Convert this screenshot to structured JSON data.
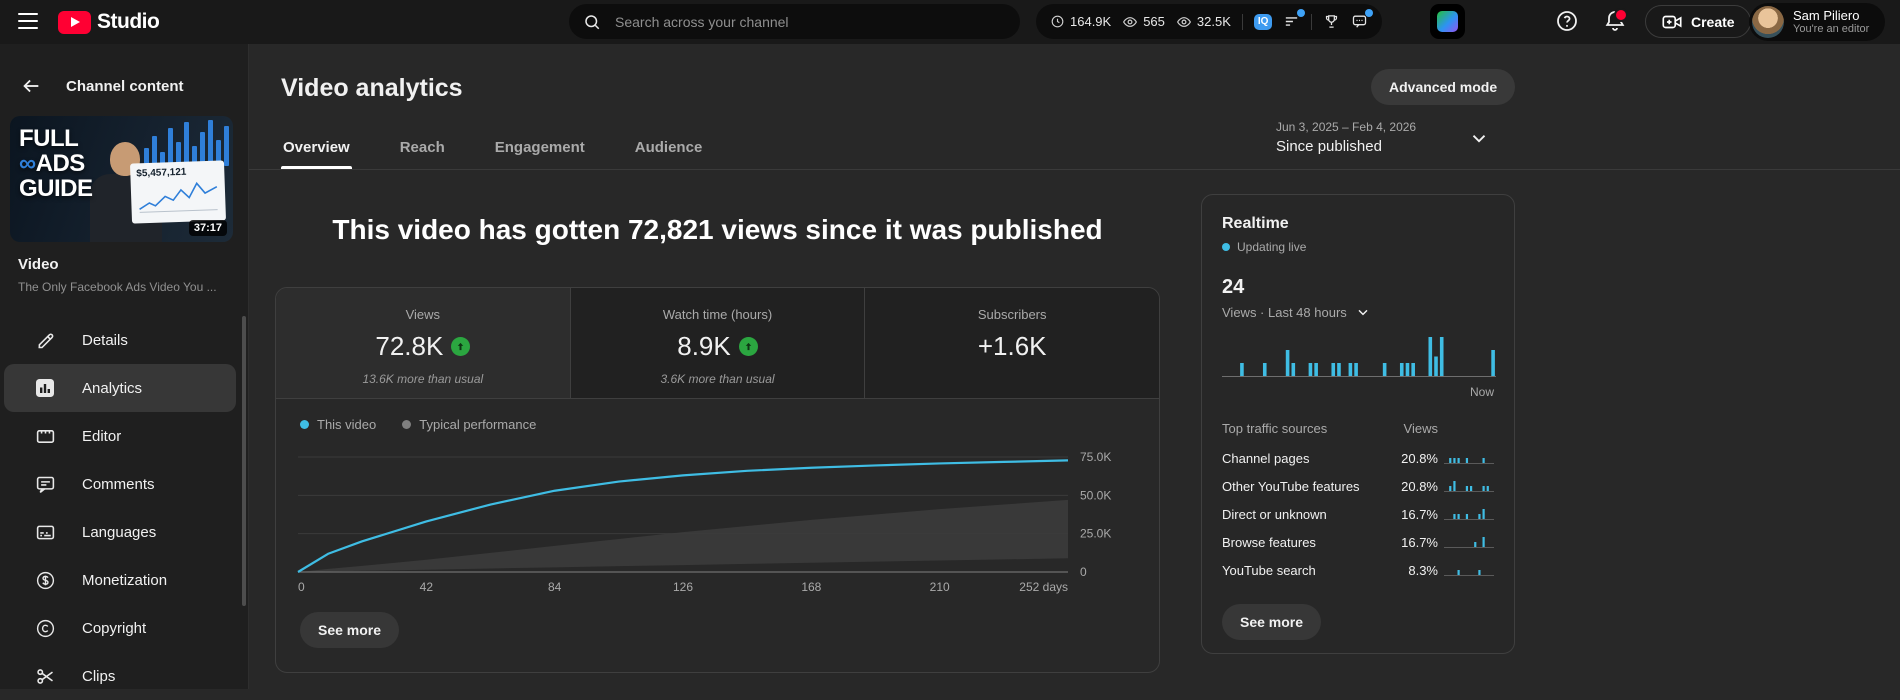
{
  "topbar": {
    "studio_label": "Studio",
    "search_placeholder": "Search across your channel",
    "stats": [
      {
        "icon": "clock",
        "value": "164.9K"
      },
      {
        "icon": "eye",
        "value": "565"
      },
      {
        "icon": "eye",
        "value": "32.5K"
      }
    ],
    "tools": [
      {
        "type": "divider"
      },
      {
        "type": "icon",
        "icon": "iq",
        "label": "IQ",
        "dot": false
      },
      {
        "type": "icon",
        "icon": "lines",
        "dot": true
      },
      {
        "type": "divider"
      },
      {
        "type": "icon",
        "icon": "trophy",
        "dot": false
      },
      {
        "type": "icon",
        "icon": "chat",
        "dot": true
      }
    ],
    "create_label": "Create",
    "user": {
      "name": "Sam Piliero",
      "role": "You're an editor"
    }
  },
  "sidebar": {
    "back_label": "Channel content",
    "thumbnail": {
      "line1": "FULL",
      "line2": "ADS",
      "line3": "GUIDE",
      "stat": "$5,457,121",
      "duration": "37:17"
    },
    "video_title": "Video",
    "video_subtitle": "The Only Facebook Ads Video You ...",
    "items": [
      {
        "label": "Details",
        "icon": "pencil",
        "active": false
      },
      {
        "label": "Analytics",
        "icon": "analytics",
        "active": true
      },
      {
        "label": "Editor",
        "icon": "editor",
        "active": false
      },
      {
        "label": "Comments",
        "icon": "comment",
        "active": false
      },
      {
        "label": "Languages",
        "icon": "subtitles",
        "active": false
      },
      {
        "label": "Monetization",
        "icon": "dollar",
        "active": false
      },
      {
        "label": "Copyright",
        "icon": "copyright",
        "active": false
      },
      {
        "label": "Clips",
        "icon": "scissors",
        "active": false
      }
    ]
  },
  "header": {
    "title": "Video analytics",
    "advanced_mode_label": "Advanced mode",
    "tabs": [
      "Overview",
      "Reach",
      "Engagement",
      "Audience"
    ],
    "active_tab": "Overview",
    "date_range": "Jun 3, 2025 – Feb 4, 2026",
    "date_mode": "Since published"
  },
  "main": {
    "headline": "This video has gotten 72,821 views since it was published",
    "metrics": [
      {
        "label": "Views",
        "value": "72.8K",
        "trend": "up",
        "note": "13.6K more than usual",
        "selected": true
      },
      {
        "label": "Watch time (hours)",
        "value": "8.9K",
        "trend": "up",
        "note": "3.6K more than usual",
        "selected": false
      },
      {
        "label": "Subscribers",
        "value": "+1.6K",
        "trend": "",
        "note": "",
        "selected": false
      }
    ],
    "legend": [
      {
        "label": "This video",
        "color": "#3fbde4"
      },
      {
        "label": "Typical performance",
        "color": "#7f7f7f"
      }
    ],
    "see_more_label": "See more"
  },
  "chart_data": {
    "type": "line",
    "title": "Views since published",
    "xlabel": "days",
    "ylim": [
      0,
      80000
    ],
    "x": [
      0,
      10,
      21,
      42,
      63,
      84,
      105,
      126,
      147,
      168,
      189,
      210,
      231,
      252
    ],
    "series": [
      {
        "name": "This video",
        "values": [
          0,
          12000,
          20000,
          33000,
          44000,
          53000,
          59000,
          63000,
          66000,
          68000,
          69500,
          70800,
          71800,
          72800
        ]
      },
      {
        "name": "Typical performance upper",
        "values": [
          0,
          2000,
          4000,
          8000,
          12500,
          17000,
          21500,
          26000,
          30000,
          34000,
          37500,
          41000,
          44000,
          47000
        ]
      },
      {
        "name": "Typical performance lower",
        "values": [
          0,
          400,
          800,
          1500,
          2300,
          3000,
          3800,
          4500,
          5300,
          6000,
          6800,
          7500,
          8200,
          9000
        ]
      }
    ],
    "yticks": [
      {
        "v": 0,
        "label": "0"
      },
      {
        "v": 25000,
        "label": "25.0K"
      },
      {
        "v": 50000,
        "label": "50.0K"
      },
      {
        "v": 75000,
        "label": "75.0K"
      }
    ],
    "xticks": [
      {
        "day": 0,
        "label": "0"
      },
      {
        "day": 42,
        "label": "42"
      },
      {
        "day": 84,
        "label": "84"
      },
      {
        "day": 126,
        "label": "126"
      },
      {
        "day": 168,
        "label": "168"
      },
      {
        "day": 210,
        "label": "210"
      },
      {
        "day": 252,
        "label": "252 days"
      }
    ]
  },
  "realtime": {
    "title": "Realtime",
    "live_label": "Updating live",
    "views_value": "24",
    "views_label": "Views · Last 48 hours",
    "now_label": "Now",
    "bars": [
      0,
      0,
      0,
      1,
      0,
      0,
      0,
      1,
      0,
      0,
      0,
      2,
      1,
      0,
      0,
      1,
      1,
      0,
      0,
      1,
      1,
      0,
      1,
      1,
      0,
      0,
      0,
      0,
      1,
      0,
      0,
      1,
      1,
      1,
      0,
      0,
      3,
      1.5,
      3,
      0,
      0,
      0,
      0,
      0,
      0,
      0,
      0,
      2
    ],
    "table": {
      "col_sources": "Top traffic sources",
      "col_views": "Views",
      "rows": [
        {
          "source": "Channel pages",
          "value": "20.8%",
          "spark": [
            0,
            1,
            1,
            1,
            0,
            1,
            0,
            0,
            0,
            1,
            0,
            0
          ]
        },
        {
          "source": "Other YouTube features",
          "value": "20.8%",
          "spark": [
            0,
            1,
            2,
            0,
            0,
            1,
            1,
            0,
            0,
            1,
            1,
            0
          ]
        },
        {
          "source": "Direct or unknown",
          "value": "16.7%",
          "spark": [
            0,
            0,
            1,
            1,
            0,
            1,
            0,
            0,
            1,
            2,
            0,
            0
          ]
        },
        {
          "source": "Browse features",
          "value": "16.7%",
          "spark": [
            0,
            0,
            0,
            0,
            0,
            0,
            0,
            1,
            0,
            2,
            0,
            0
          ]
        },
        {
          "source": "YouTube search",
          "value": "8.3%",
          "spark": [
            0,
            0,
            0,
            1,
            0,
            0,
            0,
            0,
            1,
            0,
            0,
            0
          ]
        }
      ]
    },
    "see_more_label": "See more"
  }
}
